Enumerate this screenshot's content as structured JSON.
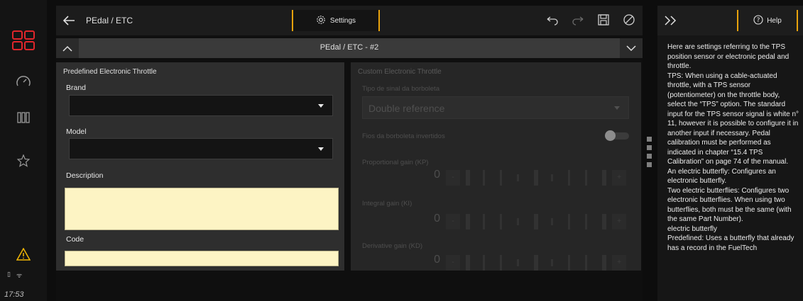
{
  "rail": {
    "time": "17:53"
  },
  "header": {
    "title": "PEdal / ETC",
    "settings_label": "Settings"
  },
  "selector": {
    "name": "PEdal / ETC - #2"
  },
  "left_panel": {
    "title": "Predefined Electronic Throttle",
    "brand_label": "Brand",
    "model_label": "Model",
    "description_label": "Description",
    "code_label": "Code"
  },
  "right_panel": {
    "title": "Custom Electronic Throttle",
    "signal_label": "Tipo de sinal da borboleta",
    "signal_value": "Double reference",
    "inverted_label": "Fios da borboleta invertidos",
    "sliders": [
      {
        "label": "Proportional gain (KP)",
        "value": "0",
        "minus": "-",
        "plus": "+"
      },
      {
        "label": "Integral gain (KI)",
        "value": "0",
        "minus": "-",
        "plus": "+"
      },
      {
        "label": "Derivative gain (KD)",
        "value": "0",
        "minus": "-",
        "plus": "+"
      }
    ]
  },
  "help": {
    "button_label": "Help",
    "text": "Here are settings referring to the TPS position sensor or electronic pedal and throttle.\nTPS: When using a cable-actuated throttle, with a TPS sensor (potentiometer) on the throttle body, select the “TPS” option. The standard input for the TPS sensor signal is white n° 11, however it is possible to configure it in another input if necessary. Pedal calibration must be performed as indicated in chapter “15.4 TPS Calibration” on page 74 of the manual.\nAn electric butterfly: Configures an electronic butterfly.\nTwo electric butterflies: Configures two electronic butterflies. When using two butterflies, both must be the same (with the same Part Number).\nelectric butterfly\nPredefined: Uses a butterfly that already has a record in the FuelTech"
  }
}
